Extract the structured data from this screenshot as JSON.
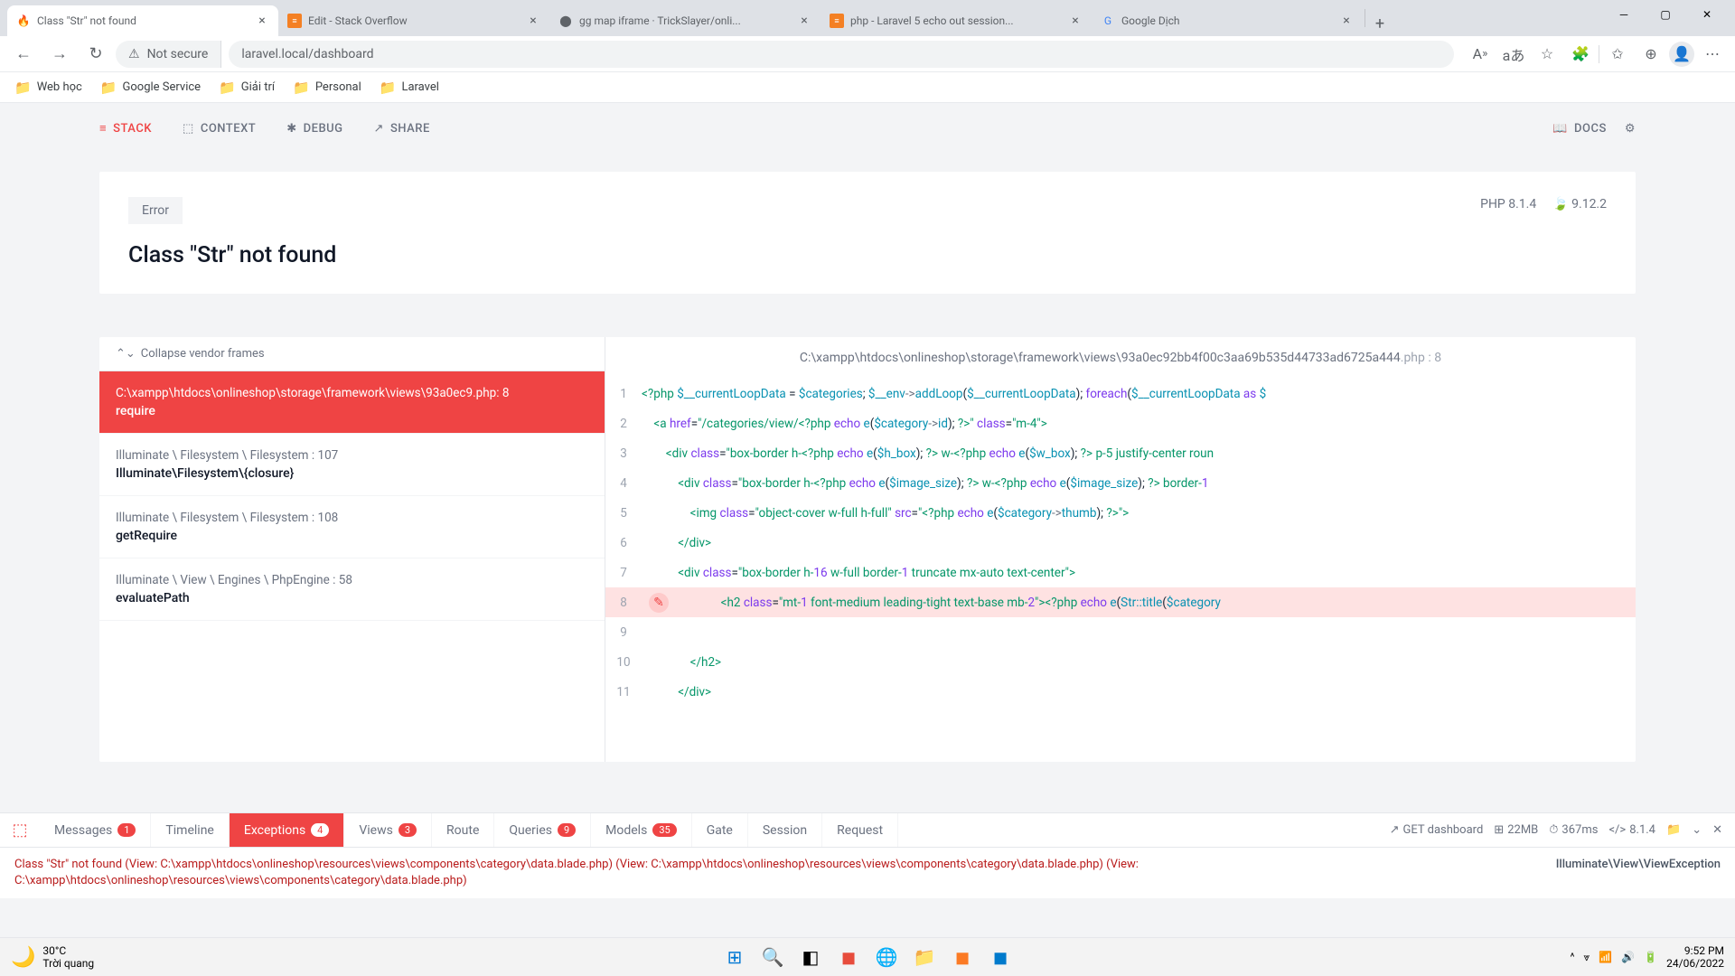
{
  "browser": {
    "tabs": [
      {
        "title": "Class \"Str\" not found",
        "favicon": "🐛"
      },
      {
        "title": "Edit - Stack Overflow",
        "favicon": "so"
      },
      {
        "title": "gg map iframe · TrickSlayer/onli...",
        "favicon": "gh"
      },
      {
        "title": "php - Laravel 5 echo out session...",
        "favicon": "so"
      },
      {
        "title": "Google Dịch",
        "favicon": "gt"
      }
    ],
    "addressbar": {
      "notsecure": "Not secure",
      "url": "laravel.local/dashboard"
    },
    "bookmarks": [
      {
        "label": "Web học"
      },
      {
        "label": "Google Service"
      },
      {
        "label": "Giải trí"
      },
      {
        "label": "Personal"
      },
      {
        "label": "Laravel"
      }
    ]
  },
  "topnav": {
    "stack": "STACK",
    "context": "CONTEXT",
    "debug": "DEBUG",
    "share": "SHARE",
    "docs": "DOCS"
  },
  "error": {
    "badge": "Error",
    "title": "Class \"Str\" not found",
    "php": "PHP 8.1.4",
    "laravel": "9.12.2"
  },
  "frames": {
    "collapse": "Collapse vendor frames",
    "items": [
      {
        "path": "C:\\xampp\\htdocs\\onlineshop\\storage\\framework\\views\\93a0ec9.php",
        "line": ": 8",
        "func": "require",
        "active": true
      },
      {
        "path": "Illuminate \\ Filesystem \\ Filesystem",
        "line": " : 107",
        "func": "Illuminate\\Filesystem\\{closure}"
      },
      {
        "path": "Illuminate \\ Filesystem \\ Filesystem",
        "line": " : 108",
        "func": "getRequire"
      },
      {
        "path": "Illuminate \\ View \\ Engines \\ PhpEngine",
        "line": " : 58",
        "func": "evaluatePath"
      }
    ]
  },
  "code": {
    "path": "C:\\xampp\\htdocs\\onlineshop\\storage\\framework\\views\\93a0ec92bb4f00c3aa69b535d44733ad6725a444",
    "ext": ".php : 8"
  },
  "debugbar": {
    "tabs": {
      "messages": {
        "label": "Messages",
        "badge": "1"
      },
      "timeline": {
        "label": "Timeline"
      },
      "exceptions": {
        "label": "Exceptions",
        "badge": "4"
      },
      "views": {
        "label": "Views",
        "badge": "3"
      },
      "route": {
        "label": "Route"
      },
      "queries": {
        "label": "Queries",
        "badge": "9"
      },
      "models": {
        "label": "Models",
        "badge": "35"
      },
      "gate": {
        "label": "Gate"
      },
      "session": {
        "label": "Session"
      },
      "request": {
        "label": "Request"
      }
    },
    "right": {
      "method": "GET dashboard",
      "memory": "22MB",
      "time": "367ms",
      "version": "8.1.4"
    },
    "content": "Class \"Str\" not found (View: C:\\xampp\\htdocs\\onlineshop\\resources\\views\\components\\category\\data.blade.php) (View: C:\\xampp\\htdocs\\onlineshop\\resources\\views\\components\\category\\data.blade.php) (View:",
    "content2": "C:\\xampp\\htdocs\\onlineshop\\resources\\views\\components\\category\\data.blade.php)",
    "classname": "Illuminate\\View\\ViewException"
  },
  "taskbar": {
    "temp": "30°C",
    "weather": "Trời quang",
    "time": "9:52 PM",
    "date": "24/06/2022"
  }
}
